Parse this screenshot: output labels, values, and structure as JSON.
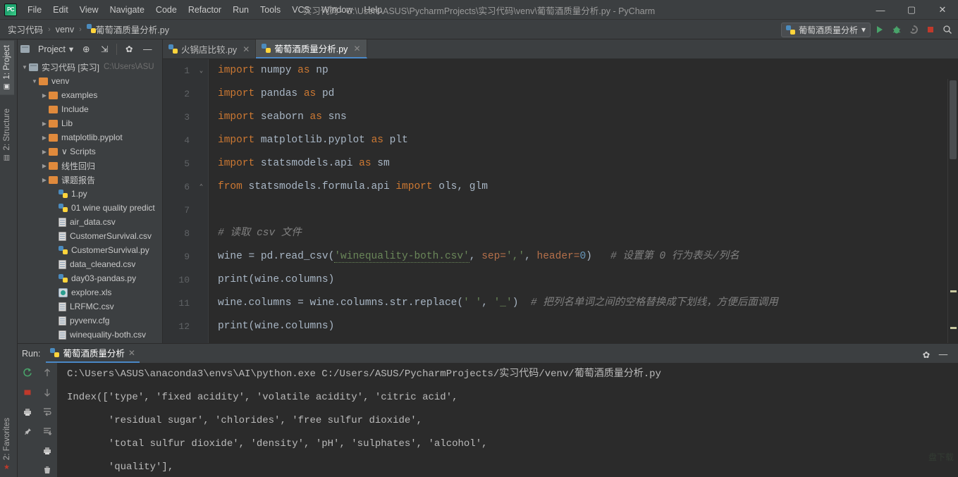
{
  "window": {
    "title": "实习代码 - C:\\Users\\ASUS\\PycharmProjects\\实习代码\\venv\\葡萄酒质量分析.py - PyCharm",
    "logo_text": "PC",
    "minimize": "—",
    "maximize": "▢",
    "close": "✕"
  },
  "menubar": [
    {
      "label": "File"
    },
    {
      "label": "Edit"
    },
    {
      "label": "View"
    },
    {
      "label": "Navigate"
    },
    {
      "label": "Code"
    },
    {
      "label": "Refactor"
    },
    {
      "label": "Run"
    },
    {
      "label": "Tools"
    },
    {
      "label": "VCS"
    },
    {
      "label": "Window"
    },
    {
      "label": "Help"
    }
  ],
  "breadcrumb": {
    "items": [
      "实习代码",
      "venv",
      "葡萄酒质量分析.py"
    ],
    "separator": "›"
  },
  "navbar_right": {
    "run_config": "葡萄酒质量分析",
    "dropdown_glyph": "▾",
    "buttons": [
      {
        "name": "run-button",
        "title": "Run"
      },
      {
        "name": "debug-button",
        "title": "Debug"
      },
      {
        "name": "coverage-button",
        "title": "Run with Coverage"
      },
      {
        "name": "stop-button",
        "title": "Stop"
      },
      {
        "name": "search-button",
        "title": "Search Everywhere"
      }
    ]
  },
  "tool_strip": {
    "top": {
      "label": "1: Project",
      "glyph": "▣"
    },
    "middle": {
      "label": "2: Structure",
      "glyph": "▥"
    },
    "bottom": {
      "label": "2: Favorites",
      "glyph": "★"
    }
  },
  "project_panel": {
    "title": "Project",
    "dropdown_glyph": "▾",
    "buttons": [
      {
        "name": "locate-icon",
        "glyph": "⊕"
      },
      {
        "name": "collapse-all-icon",
        "glyph": "⇲"
      },
      {
        "name": "settings-gear-icon",
        "glyph": "✿"
      },
      {
        "name": "hide-panel-icon",
        "glyph": "—"
      }
    ],
    "tree": [
      {
        "label": "实习代码 [实习]",
        "path": "C:\\Users\\ASU",
        "depth": 0,
        "arrow": "▼",
        "icon": "folder-blue"
      },
      {
        "label": "venv",
        "depth": 1,
        "arrow": "▼",
        "icon": "folder"
      },
      {
        "label": "examples",
        "depth": 2,
        "arrow": "▶",
        "icon": "folder"
      },
      {
        "label": "Include",
        "depth": 2,
        "arrow": "",
        "icon": "folder"
      },
      {
        "label": "Lib",
        "depth": 2,
        "arrow": "▶",
        "icon": "folder"
      },
      {
        "label": "matplotlib.pyplot",
        "depth": 2,
        "arrow": "▶",
        "icon": "folder"
      },
      {
        "label": "∨ Scripts",
        "depth": 2,
        "arrow": "▶",
        "icon": "folder"
      },
      {
        "label": "线性回归",
        "depth": 2,
        "arrow": "▶",
        "icon": "folder"
      },
      {
        "label": "课题报告",
        "depth": 2,
        "arrow": "▶",
        "icon": "folder"
      },
      {
        "label": "1.py",
        "depth": 3,
        "arrow": "",
        "icon": "py"
      },
      {
        "label": "01 wine quality predict",
        "depth": 3,
        "arrow": "",
        "icon": "py"
      },
      {
        "label": "air_data.csv",
        "depth": 3,
        "arrow": "",
        "icon": "csv"
      },
      {
        "label": "CustomerSurvival.csv",
        "depth": 3,
        "arrow": "",
        "icon": "csv"
      },
      {
        "label": "CustomerSurvival.py",
        "depth": 3,
        "arrow": "",
        "icon": "py"
      },
      {
        "label": "data_cleaned.csv",
        "depth": 3,
        "arrow": "",
        "icon": "csv"
      },
      {
        "label": "day03-pandas.py",
        "depth": 3,
        "arrow": "",
        "icon": "py"
      },
      {
        "label": "explore.xls",
        "depth": 3,
        "arrow": "",
        "icon": "xls"
      },
      {
        "label": "LRFMC.csv",
        "depth": 3,
        "arrow": "",
        "icon": "csv"
      },
      {
        "label": "pyvenv.cfg",
        "depth": 3,
        "arrow": "",
        "icon": "csv"
      },
      {
        "label": "winequality-both.csv",
        "depth": 3,
        "arrow": "",
        "icon": "csv"
      }
    ]
  },
  "editor": {
    "tabs": [
      {
        "label": "火锅店比较.py",
        "active": false,
        "close": "✕"
      },
      {
        "label": "葡萄酒质量分析.py",
        "active": true,
        "close": "✕"
      }
    ],
    "line_numbers": [
      "1",
      "2",
      "3",
      "4",
      "5",
      "6",
      "7",
      "8",
      "9",
      "10",
      "11",
      "12"
    ],
    "lines": [
      [
        {
          "t": "import ",
          "c": "kw"
        },
        {
          "t": "numpy ",
          "c": ""
        },
        {
          "t": "as ",
          "c": "kw"
        },
        {
          "t": "np",
          "c": ""
        }
      ],
      [
        {
          "t": "import ",
          "c": "kw"
        },
        {
          "t": "pandas ",
          "c": ""
        },
        {
          "t": "as ",
          "c": "kw"
        },
        {
          "t": "pd",
          "c": ""
        }
      ],
      [
        {
          "t": "import ",
          "c": "kw"
        },
        {
          "t": "seaborn ",
          "c": ""
        },
        {
          "t": "as ",
          "c": "kw"
        },
        {
          "t": "sns",
          "c": ""
        }
      ],
      [
        {
          "t": "import ",
          "c": "kw"
        },
        {
          "t": "matplotlib.pyplot ",
          "c": ""
        },
        {
          "t": "as ",
          "c": "kw"
        },
        {
          "t": "plt",
          "c": ""
        }
      ],
      [
        {
          "t": "import ",
          "c": "kw"
        },
        {
          "t": "statsmodels.api ",
          "c": ""
        },
        {
          "t": "as ",
          "c": "kw"
        },
        {
          "t": "sm",
          "c": ""
        }
      ],
      [
        {
          "t": "from ",
          "c": "kw"
        },
        {
          "t": "statsmodels.formula.api ",
          "c": ""
        },
        {
          "t": "import ",
          "c": "kw"
        },
        {
          "t": "ols, glm",
          "c": ""
        }
      ],
      [],
      [
        {
          "t": "# 读取 csv 文件",
          "c": "cmt"
        }
      ],
      [
        {
          "t": "wine = pd.",
          "c": ""
        },
        {
          "t": "read_csv",
          "c": ""
        },
        {
          "t": "(",
          "c": ""
        },
        {
          "t": "'winequality-both.csv'",
          "c": "str spell"
        },
        {
          "t": ", ",
          "c": ""
        },
        {
          "t": "sep=",
          "c": "param"
        },
        {
          "t": "','",
          "c": "str"
        },
        {
          "t": ", ",
          "c": ""
        },
        {
          "t": "header=",
          "c": "param"
        },
        {
          "t": "0",
          "c": "num"
        },
        {
          "t": ")   ",
          "c": ""
        },
        {
          "t": "# 设置第 0 行为表头/列名",
          "c": "cmt"
        }
      ],
      [
        {
          "t": "print",
          "c": ""
        },
        {
          "t": "(wine.columns)",
          "c": ""
        }
      ],
      [
        {
          "t": "wine.columns = wine.columns.str.",
          "c": ""
        },
        {
          "t": "replace",
          "c": ""
        },
        {
          "t": "(",
          "c": ""
        },
        {
          "t": "' '",
          "c": "str"
        },
        {
          "t": ", ",
          "c": ""
        },
        {
          "t": "'_'",
          "c": "str"
        },
        {
          "t": ")  ",
          "c": ""
        },
        {
          "t": "# 把列名单词之间的空格替换成下划线，方便后面调用",
          "c": "cmt"
        }
      ],
      [
        {
          "t": "print(wine.columns)",
          "c": ""
        }
      ]
    ]
  },
  "run_panel": {
    "label": "Run:",
    "tab_label": "葡萄酒质量分析",
    "tab_close": "✕",
    "gear_glyph": "✿",
    "minimize_glyph": "—",
    "toolbar_left": [
      {
        "name": "rerun-icon",
        "title": "Rerun"
      },
      {
        "name": "stop-icon",
        "title": "Stop"
      },
      {
        "name": "print-icon",
        "title": "Print"
      },
      {
        "name": "pin-icon",
        "title": "Pin Tab"
      }
    ],
    "toolbar_right": [
      {
        "name": "up-arrow-icon",
        "title": "Previous Occurrence"
      },
      {
        "name": "down-arrow-icon",
        "title": "Next Occurrence"
      },
      {
        "name": "soft-wrap-icon",
        "title": "Soft-Wrap"
      },
      {
        "name": "scroll-to-end-icon",
        "title": "Scroll to End"
      },
      {
        "name": "print-console-icon",
        "title": "Print"
      },
      {
        "name": "clear-all-icon",
        "title": "Clear All"
      }
    ],
    "console_lines": [
      "C:\\Users\\ASUS\\anaconda3\\envs\\AI\\python.exe C:/Users/ASUS/PycharmProjects/实习代码/venv/葡萄酒质量分析.py",
      "Index(['type', 'fixed acidity', 'volatile acidity', 'citric acid',",
      "       'residual sugar', 'chlorides', 'free sulfur dioxide',",
      "       'total sulfur dioxide', 'density', 'pH', 'sulphates', 'alcohol',",
      "       'quality'],"
    ]
  },
  "colors": {
    "accent": "#4a88c7",
    "panel_bg": "#3c3f41",
    "editor_bg": "#2b2b2b",
    "keyword": "#cc7832",
    "string": "#6a8759",
    "number": "#6897bb",
    "comment": "#808080",
    "folder": "#e08a3c",
    "stop_red": "#c0392b",
    "run_green": "#49a36a"
  }
}
